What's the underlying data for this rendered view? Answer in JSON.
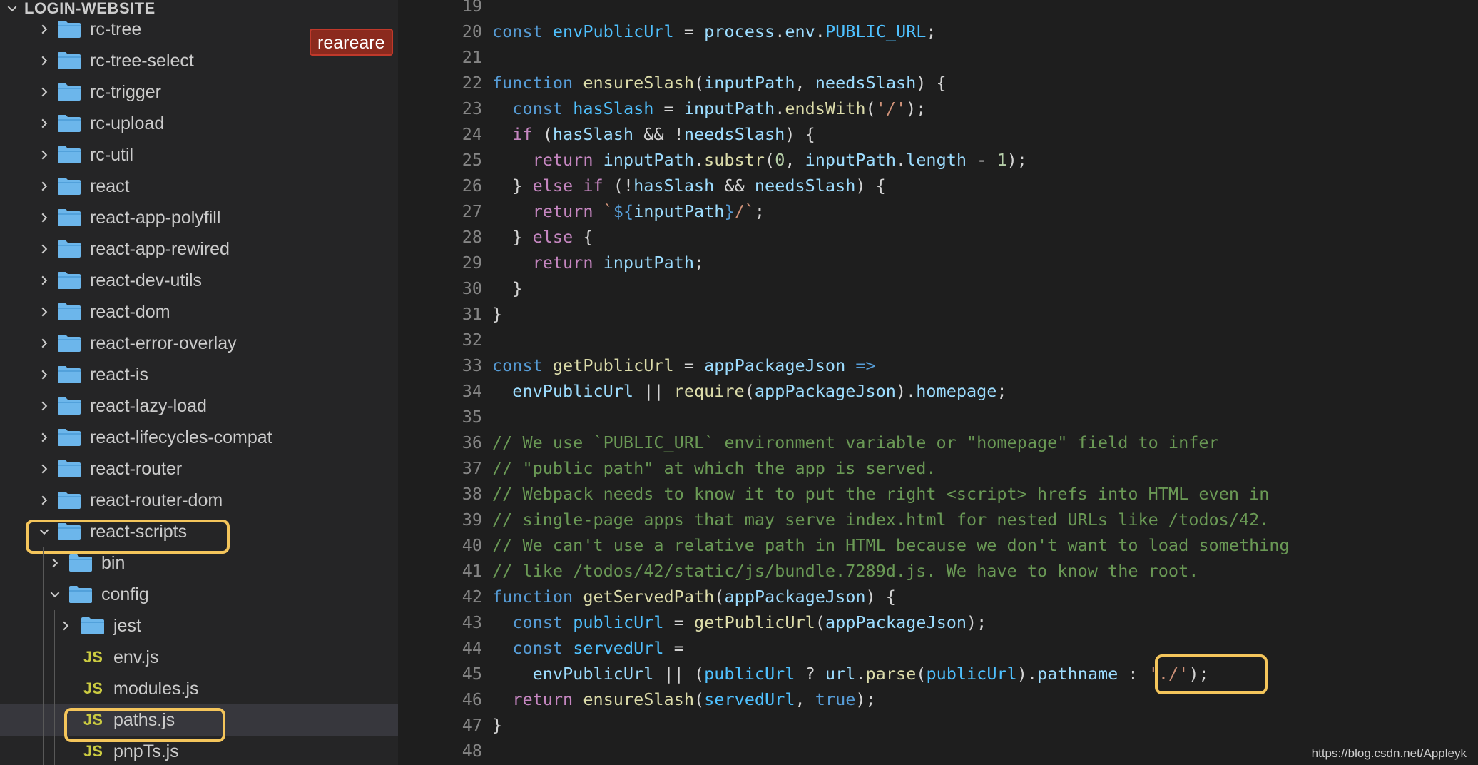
{
  "explorer": {
    "title": "LOGIN-WEBSITE",
    "badge": "reareare",
    "items": [
      {
        "label": "rc-tree",
        "type": "folder",
        "depth": 0,
        "expanded": false
      },
      {
        "label": "rc-tree-select",
        "type": "folder",
        "depth": 0,
        "expanded": false
      },
      {
        "label": "rc-trigger",
        "type": "folder",
        "depth": 0,
        "expanded": false
      },
      {
        "label": "rc-upload",
        "type": "folder",
        "depth": 0,
        "expanded": false
      },
      {
        "label": "rc-util",
        "type": "folder",
        "depth": 0,
        "expanded": false
      },
      {
        "label": "react",
        "type": "folder",
        "depth": 0,
        "expanded": false
      },
      {
        "label": "react-app-polyfill",
        "type": "folder",
        "depth": 0,
        "expanded": false
      },
      {
        "label": "react-app-rewired",
        "type": "folder",
        "depth": 0,
        "expanded": false
      },
      {
        "label": "react-dev-utils",
        "type": "folder",
        "depth": 0,
        "expanded": false
      },
      {
        "label": "react-dom",
        "type": "folder",
        "depth": 0,
        "expanded": false
      },
      {
        "label": "react-error-overlay",
        "type": "folder",
        "depth": 0,
        "expanded": false
      },
      {
        "label": "react-is",
        "type": "folder",
        "depth": 0,
        "expanded": false
      },
      {
        "label": "react-lazy-load",
        "type": "folder",
        "depth": 0,
        "expanded": false
      },
      {
        "label": "react-lifecycles-compat",
        "type": "folder",
        "depth": 0,
        "expanded": false
      },
      {
        "label": "react-router",
        "type": "folder",
        "depth": 0,
        "expanded": false
      },
      {
        "label": "react-router-dom",
        "type": "folder",
        "depth": 0,
        "expanded": false
      },
      {
        "label": "react-scripts",
        "type": "folder",
        "depth": 0,
        "expanded": true,
        "highlighted": true
      },
      {
        "label": "bin",
        "type": "folder",
        "depth": 1,
        "expanded": false
      },
      {
        "label": "config",
        "type": "folder",
        "depth": 1,
        "expanded": true
      },
      {
        "label": "jest",
        "type": "folder",
        "depth": 2,
        "expanded": false
      },
      {
        "label": "env.js",
        "type": "js",
        "depth": 2,
        "icon_text": "JS"
      },
      {
        "label": "modules.js",
        "type": "js",
        "depth": 2,
        "icon_text": "JS"
      },
      {
        "label": "paths.js",
        "type": "js",
        "depth": 2,
        "icon_text": "JS",
        "selected": true,
        "highlighted": true
      },
      {
        "label": "pnpTs.js",
        "type": "js",
        "depth": 2,
        "icon_text": "JS"
      }
    ]
  },
  "editor": {
    "lines": [
      {
        "n": "19",
        "tokens": []
      },
      {
        "n": "20",
        "tokens": [
          [
            "kw",
            "const"
          ],
          [
            "p",
            " "
          ],
          [
            "const",
            "envPublicUrl"
          ],
          [
            "p",
            " = "
          ],
          [
            "var",
            "process"
          ],
          [
            "p",
            "."
          ],
          [
            "var",
            "env"
          ],
          [
            "p",
            "."
          ],
          [
            "const",
            "PUBLIC_URL"
          ],
          [
            "p",
            ";"
          ]
        ]
      },
      {
        "n": "21",
        "tokens": []
      },
      {
        "n": "22",
        "tokens": [
          [
            "kw",
            "function"
          ],
          [
            "p",
            " "
          ],
          [
            "fn",
            "ensureSlash"
          ],
          [
            "p",
            "("
          ],
          [
            "var",
            "inputPath"
          ],
          [
            "p",
            ", "
          ],
          [
            "var",
            "needsSlash"
          ],
          [
            "p",
            ") {"
          ]
        ]
      },
      {
        "n": "23",
        "tokens": [
          [
            "p",
            "  "
          ],
          [
            "kw",
            "const"
          ],
          [
            "p",
            " "
          ],
          [
            "const",
            "hasSlash"
          ],
          [
            "p",
            " = "
          ],
          [
            "var",
            "inputPath"
          ],
          [
            "p",
            "."
          ],
          [
            "fn",
            "endsWith"
          ],
          [
            "p",
            "("
          ],
          [
            "str",
            "'/'"
          ],
          [
            "p",
            ");"
          ]
        ]
      },
      {
        "n": "24",
        "tokens": [
          [
            "p",
            "  "
          ],
          [
            "ctl",
            "if"
          ],
          [
            "p",
            " ("
          ],
          [
            "var",
            "hasSlash"
          ],
          [
            "p",
            " && !"
          ],
          [
            "var",
            "needsSlash"
          ],
          [
            "p",
            ") {"
          ]
        ]
      },
      {
        "n": "25",
        "tokens": [
          [
            "p",
            "    "
          ],
          [
            "ctl",
            "return"
          ],
          [
            "p",
            " "
          ],
          [
            "var",
            "inputPath"
          ],
          [
            "p",
            "."
          ],
          [
            "fn",
            "substr"
          ],
          [
            "p",
            "("
          ],
          [
            "num",
            "0"
          ],
          [
            "p",
            ", "
          ],
          [
            "var",
            "inputPath"
          ],
          [
            "p",
            "."
          ],
          [
            "var",
            "length"
          ],
          [
            "p",
            " - "
          ],
          [
            "num",
            "1"
          ],
          [
            "p",
            ");"
          ]
        ]
      },
      {
        "n": "26",
        "tokens": [
          [
            "p",
            "  } "
          ],
          [
            "ctl",
            "else"
          ],
          [
            "p",
            " "
          ],
          [
            "ctl",
            "if"
          ],
          [
            "p",
            " (!"
          ],
          [
            "var",
            "hasSlash"
          ],
          [
            "p",
            " && "
          ],
          [
            "var",
            "needsSlash"
          ],
          [
            "p",
            ") {"
          ]
        ]
      },
      {
        "n": "27",
        "tokens": [
          [
            "p",
            "    "
          ],
          [
            "ctl",
            "return"
          ],
          [
            "p",
            " "
          ],
          [
            "str",
            "`"
          ],
          [
            "tpl",
            "${"
          ],
          [
            "var",
            "inputPath"
          ],
          [
            "tpl",
            "}"
          ],
          [
            "str",
            "/`"
          ],
          [
            "p",
            ";"
          ]
        ]
      },
      {
        "n": "28",
        "tokens": [
          [
            "p",
            "  } "
          ],
          [
            "ctl",
            "else"
          ],
          [
            "p",
            " {"
          ]
        ]
      },
      {
        "n": "29",
        "tokens": [
          [
            "p",
            "    "
          ],
          [
            "ctl",
            "return"
          ],
          [
            "p",
            " "
          ],
          [
            "var",
            "inputPath"
          ],
          [
            "p",
            ";"
          ]
        ]
      },
      {
        "n": "30",
        "tokens": [
          [
            "p",
            "  }"
          ]
        ]
      },
      {
        "n": "31",
        "tokens": [
          [
            "p",
            "}"
          ]
        ]
      },
      {
        "n": "32",
        "tokens": []
      },
      {
        "n": "33",
        "tokens": [
          [
            "kw",
            "const"
          ],
          [
            "p",
            " "
          ],
          [
            "fn",
            "getPublicUrl"
          ],
          [
            "p",
            " = "
          ],
          [
            "var",
            "appPackageJson"
          ],
          [
            "p",
            " "
          ],
          [
            "kw",
            "=>"
          ]
        ]
      },
      {
        "n": "34",
        "tokens": [
          [
            "p",
            "  "
          ],
          [
            "var",
            "envPublicUrl"
          ],
          [
            "p",
            " || "
          ],
          [
            "fn",
            "require"
          ],
          [
            "p",
            "("
          ],
          [
            "var",
            "appPackageJson"
          ],
          [
            "p",
            ")."
          ],
          [
            "var",
            "homepage"
          ],
          [
            "p",
            ";"
          ]
        ]
      },
      {
        "n": "35",
        "tokens": []
      },
      {
        "n": "36",
        "tokens": [
          [
            "cmt",
            "// We use `PUBLIC_URL` environment variable or \"homepage\" field to infer"
          ]
        ]
      },
      {
        "n": "37",
        "tokens": [
          [
            "cmt",
            "// \"public path\" at which the app is served."
          ]
        ]
      },
      {
        "n": "38",
        "tokens": [
          [
            "cmt",
            "// Webpack needs to know it to put the right <script> hrefs into HTML even in"
          ]
        ]
      },
      {
        "n": "39",
        "tokens": [
          [
            "cmt",
            "// single-page apps that may serve index.html for nested URLs like /todos/42."
          ]
        ]
      },
      {
        "n": "40",
        "tokens": [
          [
            "cmt",
            "// We can't use a relative path in HTML because we don't want to load something"
          ]
        ]
      },
      {
        "n": "41",
        "tokens": [
          [
            "cmt",
            "// like /todos/42/static/js/bundle.7289d.js. We have to know the root."
          ]
        ]
      },
      {
        "n": "42",
        "tokens": [
          [
            "kw",
            "function"
          ],
          [
            "p",
            " "
          ],
          [
            "fn",
            "getServedPath"
          ],
          [
            "p",
            "("
          ],
          [
            "var",
            "appPackageJson"
          ],
          [
            "p",
            ") {"
          ]
        ]
      },
      {
        "n": "43",
        "tokens": [
          [
            "p",
            "  "
          ],
          [
            "kw",
            "const"
          ],
          [
            "p",
            " "
          ],
          [
            "const",
            "publicUrl"
          ],
          [
            "p",
            " = "
          ],
          [
            "fn",
            "getPublicUrl"
          ],
          [
            "p",
            "("
          ],
          [
            "var",
            "appPackageJson"
          ],
          [
            "p",
            ");"
          ]
        ]
      },
      {
        "n": "44",
        "tokens": [
          [
            "p",
            "  "
          ],
          [
            "kw",
            "const"
          ],
          [
            "p",
            " "
          ],
          [
            "const",
            "servedUrl"
          ],
          [
            "p",
            " ="
          ]
        ]
      },
      {
        "n": "45",
        "tokens": [
          [
            "p",
            "    "
          ],
          [
            "var",
            "envPublicUrl"
          ],
          [
            "p",
            " || ("
          ],
          [
            "const",
            "publicUrl"
          ],
          [
            "p",
            " ? "
          ],
          [
            "var",
            "url"
          ],
          [
            "p",
            "."
          ],
          [
            "fn",
            "parse"
          ],
          [
            "p",
            "("
          ],
          [
            "const",
            "publicUrl"
          ],
          [
            "p",
            ")."
          ],
          [
            "var",
            "pathname"
          ],
          [
            "p",
            " : "
          ],
          [
            "str",
            "'./'"
          ],
          [
            "p",
            ");"
          ]
        ]
      },
      {
        "n": "46",
        "tokens": [
          [
            "p",
            "  "
          ],
          [
            "ctl",
            "return"
          ],
          [
            "p",
            " "
          ],
          [
            "fn",
            "ensureSlash"
          ],
          [
            "p",
            "("
          ],
          [
            "const",
            "servedUrl"
          ],
          [
            "p",
            ", "
          ],
          [
            "kw",
            "true"
          ],
          [
            "p",
            ");"
          ]
        ]
      },
      {
        "n": "47",
        "tokens": [
          [
            "p",
            "}"
          ]
        ]
      },
      {
        "n": "48",
        "tokens": []
      }
    ]
  },
  "watermark": "https://blog.csdn.net/Appleyk",
  "colors": {
    "highlight_box": "#f4c55b",
    "folder": "#6cb6eb",
    "js_icon": "#cbcb41"
  }
}
